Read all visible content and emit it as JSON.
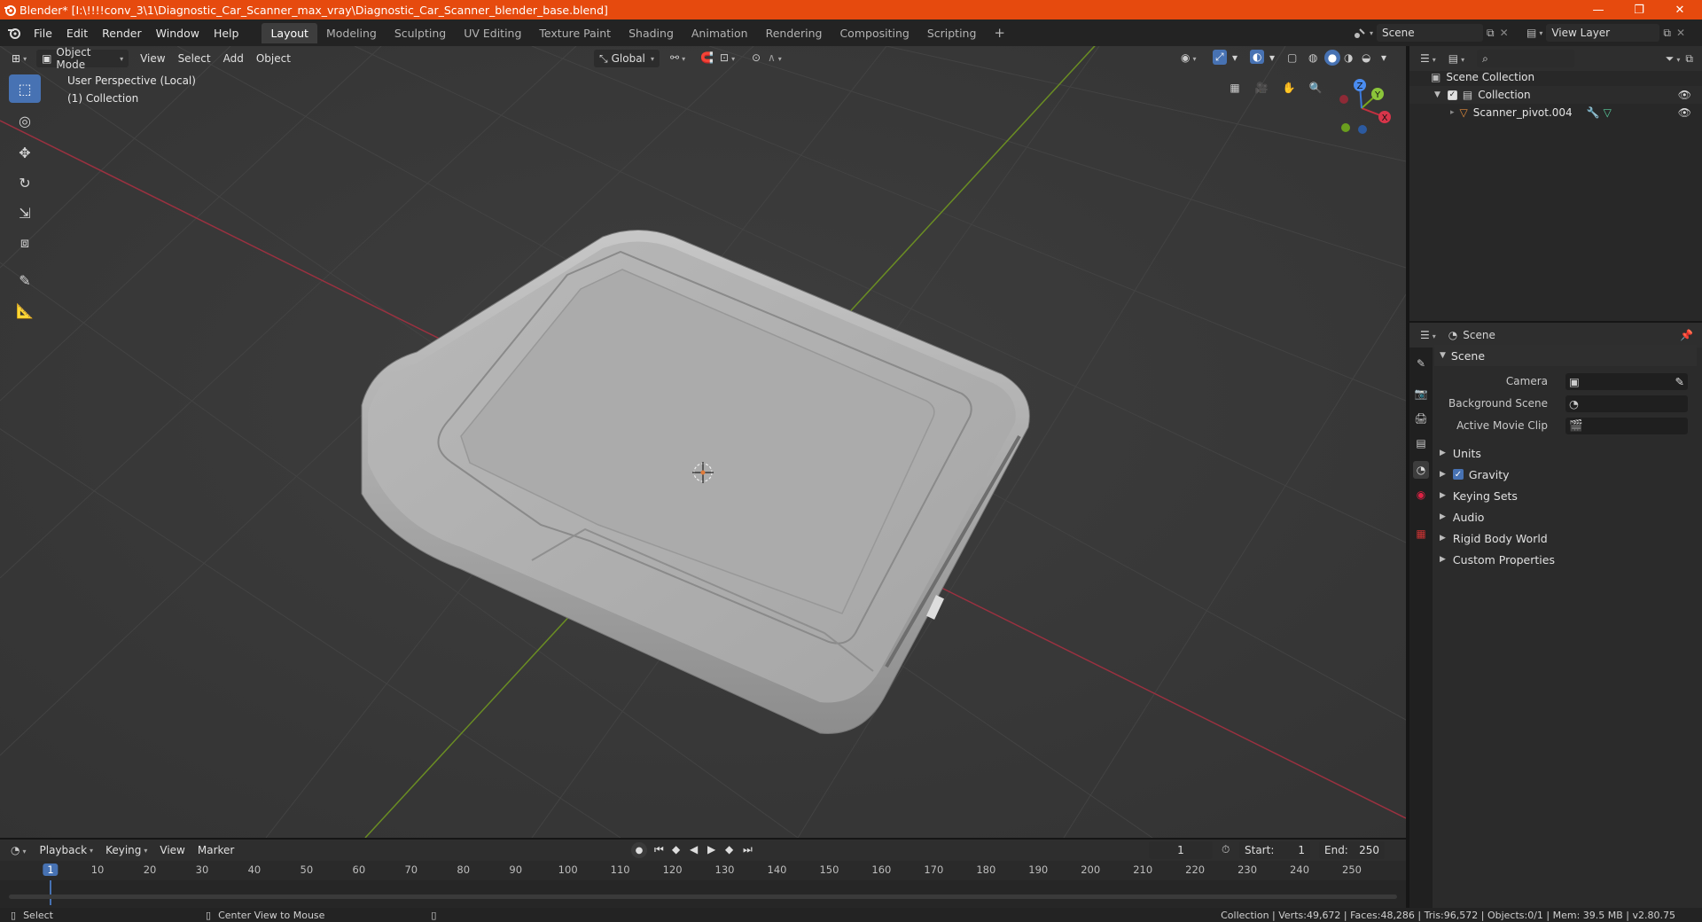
{
  "window": {
    "title": "Blender* [I:\\!!!!conv_3\\1\\Diagnostic_Car_Scanner_max_vray\\Diagnostic_Car_Scanner_blender_base.blend]",
    "minimize": "—",
    "maximize": "❐",
    "close": "✕"
  },
  "menus": [
    "File",
    "Edit",
    "Render",
    "Window",
    "Help"
  ],
  "workspaces": [
    "Layout",
    "Modeling",
    "Sculpting",
    "UV Editing",
    "Texture Paint",
    "Shading",
    "Animation",
    "Rendering",
    "Compositing",
    "Scripting"
  ],
  "add_workspace": "+",
  "scene_selector": {
    "value": "Scene"
  },
  "view_layer_selector": {
    "value": "View Layer"
  },
  "viewport": {
    "mode": "Object Mode",
    "menus": [
      "View",
      "Select",
      "Add",
      "Object"
    ],
    "transform_orientation": "Global",
    "overlay_info": {
      "line1": "User Perspective (Local)",
      "line2": "(1) Collection"
    },
    "gizmo": {
      "x": "X",
      "y": "Y",
      "z": "Z"
    }
  },
  "outliner": {
    "scene_collection": "Scene Collection",
    "collection": "Collection",
    "object": "Scanner_pivot.004"
  },
  "properties": {
    "header": "Scene",
    "panel_title": "Scene",
    "fields": [
      {
        "label": "Camera",
        "value": ""
      },
      {
        "label": "Background Scene",
        "value": ""
      },
      {
        "label": "Active Movie Clip",
        "value": ""
      }
    ],
    "subpanels": [
      "Units",
      "Gravity",
      "Keying Sets",
      "Audio",
      "Rigid Body World",
      "Custom Properties"
    ],
    "gravity_checked": true
  },
  "timeline": {
    "menus": [
      "Playback",
      "Keying",
      "View",
      "Marker"
    ],
    "current_frame": "1",
    "start_label": "Start:",
    "start": "1",
    "end_label": "End:",
    "end": "250",
    "ticks": [
      "1",
      "10",
      "20",
      "30",
      "40",
      "50",
      "60",
      "70",
      "80",
      "90",
      "100",
      "110",
      "120",
      "130",
      "140",
      "150",
      "160",
      "170",
      "180",
      "190",
      "200",
      "210",
      "220",
      "230",
      "240",
      "250"
    ]
  },
  "status": {
    "left": "Select",
    "middle": "Center View to Mouse",
    "right": "Collection | Verts:49,672 | Faces:48,286 | Tris:96,572 | Objects:0/1 | Mem: 39.5 MB | v2.80.75"
  },
  "colors": {
    "title_bar": "#e64a0e",
    "accent": "#4772b3",
    "x_axis": "#c2303f",
    "y_axis": "#7aa81e",
    "z_axis": "#3b78d9"
  }
}
